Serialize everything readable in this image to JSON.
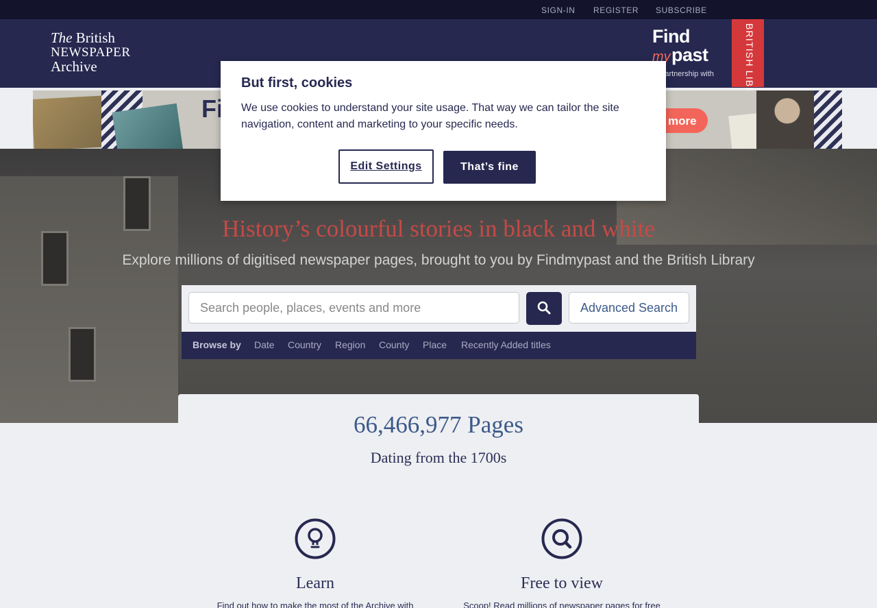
{
  "topbar": {
    "signin": "SIGN-IN",
    "register": "REGISTER",
    "subscribe": "SUBSCRIBE"
  },
  "logo": {
    "line1_italic": "The",
    "line1_rest": " British",
    "line2": "NEWSPAPER",
    "line3": "Archive"
  },
  "partner": {
    "find": "Find",
    "my": "my",
    "past": "past",
    "text": "In partnership with",
    "library": "BRITISH LIBRARY"
  },
  "banner": {
    "find": "Fi",
    "more": "more"
  },
  "hero": {
    "title": "History’s colourful stories in black and white",
    "subtitle": "Explore millions of digitised newspaper pages, brought to you by Findmypast and the British Library"
  },
  "search": {
    "placeholder": "Search people, places, events and more",
    "advanced": "Advanced Search"
  },
  "browse": {
    "label": "Browse by",
    "items": [
      "Date",
      "Country",
      "Region",
      "County",
      "Place",
      "Recently Added titles"
    ]
  },
  "stats": {
    "pages": "66,466,977 Pages",
    "dating": "Dating from the 1700s"
  },
  "features": [
    {
      "icon": "lightbulb-icon",
      "title": "Learn",
      "text": "Find out how to make the most of the Archive with"
    },
    {
      "icon": "magnifier-icon",
      "title": "Free to view",
      "text": "Scoop! Read millions of newspaper pages for free"
    }
  ],
  "cookie": {
    "title": "But first, cookies",
    "body": "We use cookies to understand your site usage. That way we can tailor the site navigation, content and marketing to your specific needs.",
    "edit": "Edit Settings",
    "accept": "That’s fine"
  },
  "colors": {
    "navy": "#262850",
    "accent_red": "#c54a46",
    "link_blue": "#3c5a8a"
  }
}
